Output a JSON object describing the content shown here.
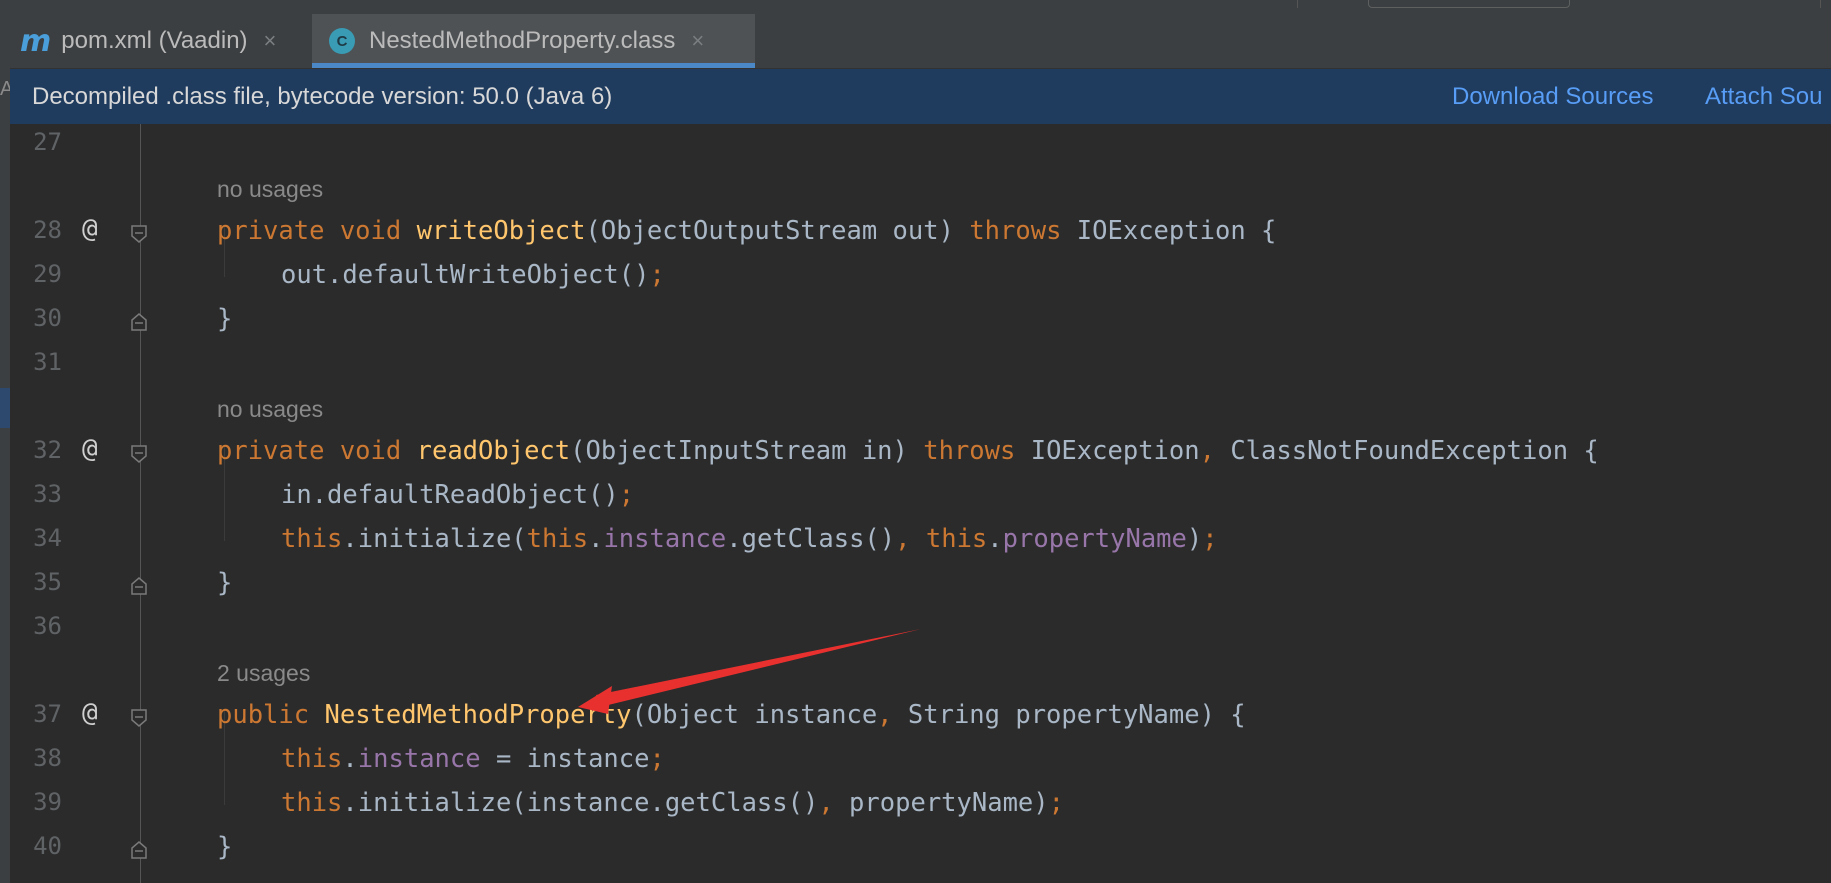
{
  "tabs": [
    {
      "label": "pom.xml (Vaadin)",
      "icon": "m-icon",
      "active": false
    },
    {
      "label": "NestedMethodProperty.class",
      "icon": "class-icon",
      "active": true
    }
  ],
  "close_glyph": "×",
  "banner": {
    "message": "Decompiled .class file, bytecode version: 50.0 (Java 6)",
    "download_sources": "Download Sources",
    "attach_sources": "Attach Sou"
  },
  "left_fragment": "A",
  "hints": {
    "h1": "no usages",
    "h2": "no usages",
    "h3": "2 usages"
  },
  "lines": {
    "l27": "27",
    "l28": "28",
    "l29": "29",
    "l30": "30",
    "l31": "31",
    "l32": "32",
    "l33": "33",
    "l34": "34",
    "l35": "35",
    "l36": "36",
    "l37": "37",
    "l38": "38",
    "l39": "39",
    "l40": "40"
  },
  "annotation_glyph": "@",
  "code": {
    "l28": [
      {
        "t": "private",
        "c": "kw"
      },
      {
        "t": " "
      },
      {
        "t": "void",
        "c": "kw"
      },
      {
        "t": " "
      },
      {
        "t": "writeObject",
        "c": "fn"
      },
      {
        "t": "(ObjectOutputStream out) "
      },
      {
        "t": "throws",
        "c": "kw"
      },
      {
        "t": " IOException {"
      }
    ],
    "l29": [
      {
        "t": "out.defaultWriteObject()"
      },
      {
        "t": ";",
        "c": "kw"
      }
    ],
    "l30": [
      {
        "t": "}"
      }
    ],
    "l32": [
      {
        "t": "private",
        "c": "kw"
      },
      {
        "t": " "
      },
      {
        "t": "void",
        "c": "kw"
      },
      {
        "t": " "
      },
      {
        "t": "readObject",
        "c": "fn"
      },
      {
        "t": "(ObjectInputStream in) "
      },
      {
        "t": "throws",
        "c": "kw"
      },
      {
        "t": " IOException"
      },
      {
        "t": ",",
        "c": "kw"
      },
      {
        "t": " ClassNotFoundException {"
      }
    ],
    "l33": [
      {
        "t": "in.defaultReadObject()"
      },
      {
        "t": ";",
        "c": "kw"
      }
    ],
    "l34": [
      {
        "t": "this",
        "c": "kw"
      },
      {
        "t": ".initialize("
      },
      {
        "t": "this",
        "c": "kw"
      },
      {
        "t": "."
      },
      {
        "t": "instance",
        "c": "fld"
      },
      {
        "t": ".getClass()"
      },
      {
        "t": ",",
        "c": "kw"
      },
      {
        "t": " "
      },
      {
        "t": "this",
        "c": "kw"
      },
      {
        "t": "."
      },
      {
        "t": "propertyName",
        "c": "fld"
      },
      {
        "t": ")"
      },
      {
        "t": ";",
        "c": "kw"
      }
    ],
    "l35": [
      {
        "t": "}"
      }
    ],
    "l37": [
      {
        "t": "public",
        "c": "kw"
      },
      {
        "t": " "
      },
      {
        "t": "NestedMethodProperty",
        "c": "fn"
      },
      {
        "t": "(Object instance"
      },
      {
        "t": ",",
        "c": "kw"
      },
      {
        "t": " String propertyName) {"
      }
    ],
    "l38": [
      {
        "t": "this",
        "c": "kw"
      },
      {
        "t": "."
      },
      {
        "t": "instance",
        "c": "fld"
      },
      {
        "t": " = instance"
      },
      {
        "t": ";",
        "c": "kw"
      }
    ],
    "l39": [
      {
        "t": "this",
        "c": "kw"
      },
      {
        "t": ".initialize(instance.getClass()"
      },
      {
        "t": ",",
        "c": "kw"
      },
      {
        "t": " propertyName)"
      },
      {
        "t": ";",
        "c": "kw"
      }
    ],
    "l40": [
      {
        "t": "}"
      }
    ]
  },
  "colors": {
    "keyword": "#cc7832",
    "method": "#ffc66d",
    "field": "#9876aa",
    "plain": "#a9b7c6",
    "hint": "#8a8a8a",
    "arrow": "#e8312f"
  }
}
